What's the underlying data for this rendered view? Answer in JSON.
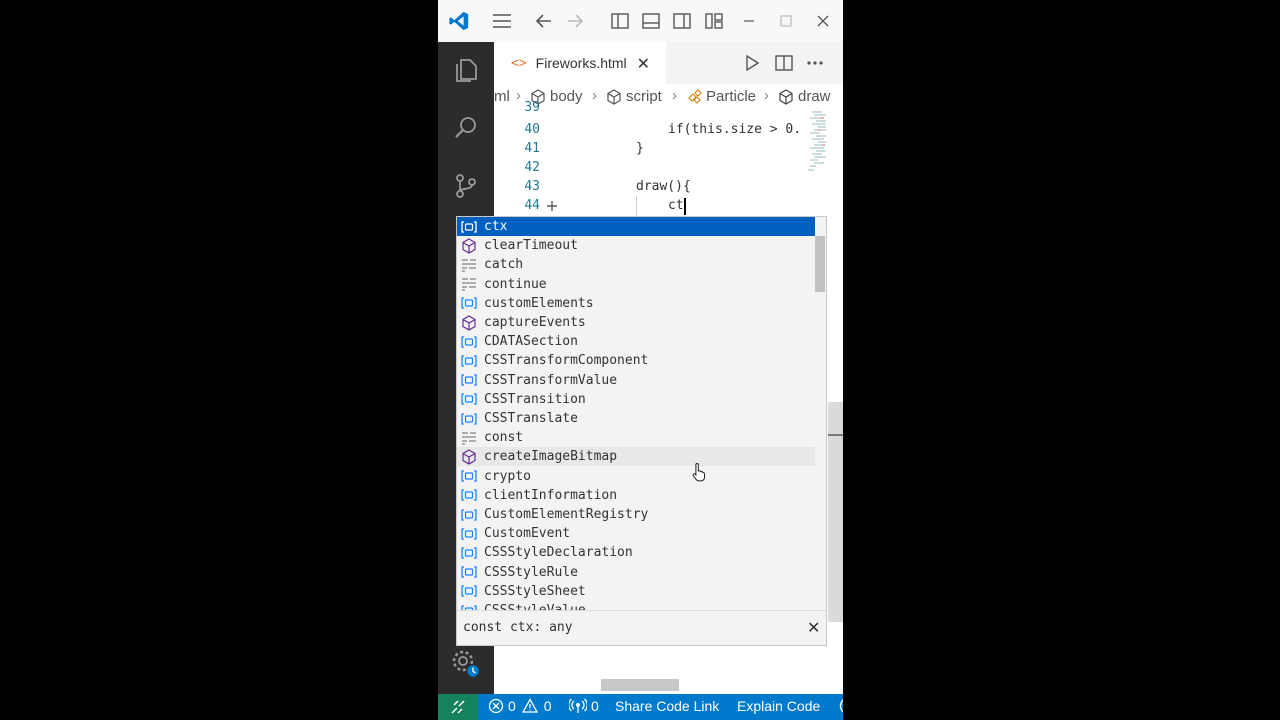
{
  "editor": {
    "tab_icon": "<>",
    "tab_label": "Fireworks.html",
    "tab_close": "✕",
    "breadcrumb": [
      "ml",
      "body",
      "script",
      "Particle",
      "draw"
    ],
    "lines": [
      {
        "num": "39",
        "text": ""
      },
      {
        "num": "40",
        "text": "if(this.size > 0."
      },
      {
        "num": "41",
        "text": "}"
      },
      {
        "num": "42",
        "text": ""
      },
      {
        "num": "43",
        "text": "draw(){"
      },
      {
        "num": "44",
        "text": "ct"
      }
    ]
  },
  "suggest": {
    "items": [
      {
        "label": "ctx",
        "kind": "variable"
      },
      {
        "label": "clearTimeout",
        "kind": "method"
      },
      {
        "label": "catch",
        "kind": "keyword"
      },
      {
        "label": "continue",
        "kind": "keyword"
      },
      {
        "label": "customElements",
        "kind": "variable"
      },
      {
        "label": "captureEvents",
        "kind": "method"
      },
      {
        "label": "CDATASection",
        "kind": "variable"
      },
      {
        "label": "CSSTransformComponent",
        "kind": "variable"
      },
      {
        "label": "CSSTransformValue",
        "kind": "variable"
      },
      {
        "label": "CSSTransition",
        "kind": "variable"
      },
      {
        "label": "CSSTranslate",
        "kind": "variable"
      },
      {
        "label": "const",
        "kind": "keyword"
      },
      {
        "label": "createImageBitmap",
        "kind": "method"
      },
      {
        "label": "crypto",
        "kind": "variable"
      },
      {
        "label": "clientInformation",
        "kind": "variable"
      },
      {
        "label": "CustomElementRegistry",
        "kind": "variable"
      },
      {
        "label": "CustomEvent",
        "kind": "variable"
      },
      {
        "label": "CSSStyleDeclaration",
        "kind": "variable"
      },
      {
        "label": "CSSStyleRule",
        "kind": "variable"
      },
      {
        "label": "CSSStyleSheet",
        "kind": "variable"
      },
      {
        "label": "CSSStyleValue",
        "kind": "variable"
      }
    ],
    "detail": "const ctx: any",
    "close": "✕"
  },
  "status": {
    "errors": "0",
    "warnings": "0",
    "ports": "0",
    "share_code_link": "Share Code Link",
    "explain_code": "Explain Code"
  },
  "colors": {
    "accent": "#007acc",
    "remote": "#16825d",
    "selection": "#0060c0",
    "activity_bar": "#2c2c2c"
  }
}
